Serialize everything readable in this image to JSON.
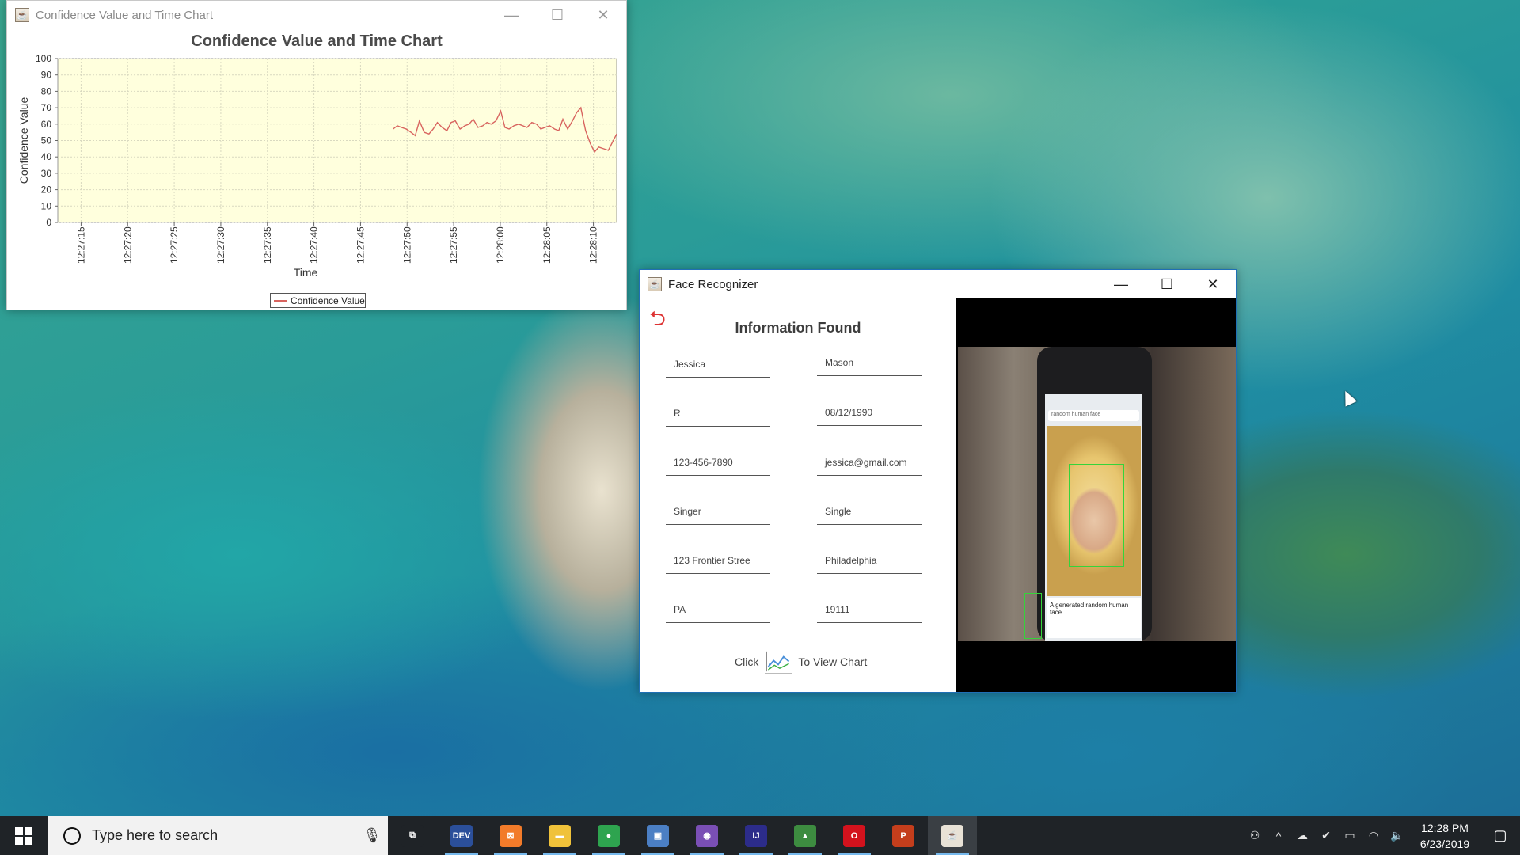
{
  "chart_window": {
    "title": "Confidence Value and Time Chart",
    "controls": {
      "minimize": "—",
      "maximize": "☐",
      "close": "✕"
    }
  },
  "chart_data": {
    "type": "line",
    "title": "Confidence Value and Time Chart",
    "xlabel": "Time",
    "ylabel": "Confidence Value",
    "ylim": [
      0,
      100
    ],
    "y_ticks": [
      "0",
      "10",
      "20",
      "30",
      "40",
      "50",
      "60",
      "70",
      "80",
      "90",
      "100"
    ],
    "x_ticks": [
      "12:27:15",
      "12:27:20",
      "12:27:25",
      "12:27:30",
      "12:27:35",
      "12:27:40",
      "12:27:45",
      "12:27:50",
      "12:27:55",
      "12:28:00",
      "12:28:05",
      "12:28:10"
    ],
    "x_range_seconds": [
      2.5,
      62.5
    ],
    "grid": true,
    "legend": "bottom-center",
    "background_color": "#ffffdd",
    "line_color": "#d8645f",
    "series": [
      {
        "name": "Confidence Value",
        "x": [
          47.8,
          48.5,
          49.2,
          50.0,
          50.8,
          51.5,
          52.2,
          53.0,
          53.8,
          54.5,
          55.2,
          56.0,
          56.8,
          57.5,
          58.2,
          59.0,
          59.8,
          60.5,
          61.2,
          62.0,
          62.8,
          63.5,
          64.2,
          65.0,
          65.8,
          66.5,
          67.2,
          68.0,
          68.8,
          69.5,
          70.2,
          71.0,
          71.8,
          72.5,
          73.2,
          74.0,
          74.8,
          75.5,
          76.2,
          77.0,
          77.8,
          78.5,
          79.2,
          80.0,
          80.8,
          81.5,
          82.2,
          83.0,
          83.8,
          84.5,
          85.2
        ],
        "y": [
          57,
          59,
          58,
          57,
          55,
          53,
          62,
          55,
          54,
          57,
          61,
          58,
          56,
          61,
          62,
          57,
          59,
          60,
          63,
          58,
          59,
          61,
          60,
          62,
          68,
          58,
          57,
          59,
          60,
          59,
          58,
          61,
          60,
          57,
          58,
          59,
          57,
          56,
          63,
          57,
          62,
          67,
          70,
          56,
          48,
          43,
          46,
          45,
          44,
          49,
          54
        ]
      }
    ]
  },
  "face_window": {
    "title": "Face Recognizer",
    "controls": {
      "minimize": "—",
      "maximize": "☐",
      "close": "✕"
    },
    "heading": "Information Found",
    "fields": [
      {
        "value": "Jessica"
      },
      {
        "value": "Mason"
      },
      {
        "value": "R"
      },
      {
        "value": "08/12/1990"
      },
      {
        "value": "123-456-7890"
      },
      {
        "value": "jessica@gmail.com"
      },
      {
        "value": "Singer"
      },
      {
        "value": "Single"
      },
      {
        "value": "123 Frontier Stree"
      },
      {
        "value": "Philadelphia"
      },
      {
        "value": "PA"
      },
      {
        "value": "19111"
      }
    ],
    "view_chart": {
      "prefix": "Click",
      "suffix": "To View Chart"
    },
    "camera": {
      "phone_search": "random human face",
      "caption": "A generated random human face"
    }
  },
  "taskbar": {
    "search_placeholder": "Type here to search",
    "apps": [
      {
        "icon": "task-view-icon",
        "label": "⧉",
        "color": "#1f2327"
      },
      {
        "icon": "dev-cpp-icon",
        "label": "DEV",
        "color": "#2b4f9a"
      },
      {
        "icon": "xampp-icon",
        "label": "⊠",
        "color": "#f27b2a"
      },
      {
        "icon": "file-explorer-icon",
        "label": "▬",
        "color": "#f0c23a"
      },
      {
        "icon": "chrome-icon",
        "label": "●",
        "color": "#2ea44f"
      },
      {
        "icon": "virtualbox-icon",
        "label": "▣",
        "color": "#4b7fc4"
      },
      {
        "icon": "github-icon",
        "label": "◉",
        "color": "#7a4fb5"
      },
      {
        "icon": "intellij-icon",
        "label": "IJ",
        "color": "#2c2c8a"
      },
      {
        "icon": "android-studio-icon",
        "label": "▲",
        "color": "#3d8c40"
      },
      {
        "icon": "opera-icon",
        "label": "O",
        "color": "#d3121d"
      },
      {
        "icon": "powerpoint-icon",
        "label": "P",
        "color": "#c43e1c"
      },
      {
        "icon": "java-icon",
        "label": "☕",
        "color": "#e8e2d6"
      }
    ],
    "time": "12:28 PM",
    "date": "6/23/2019"
  }
}
